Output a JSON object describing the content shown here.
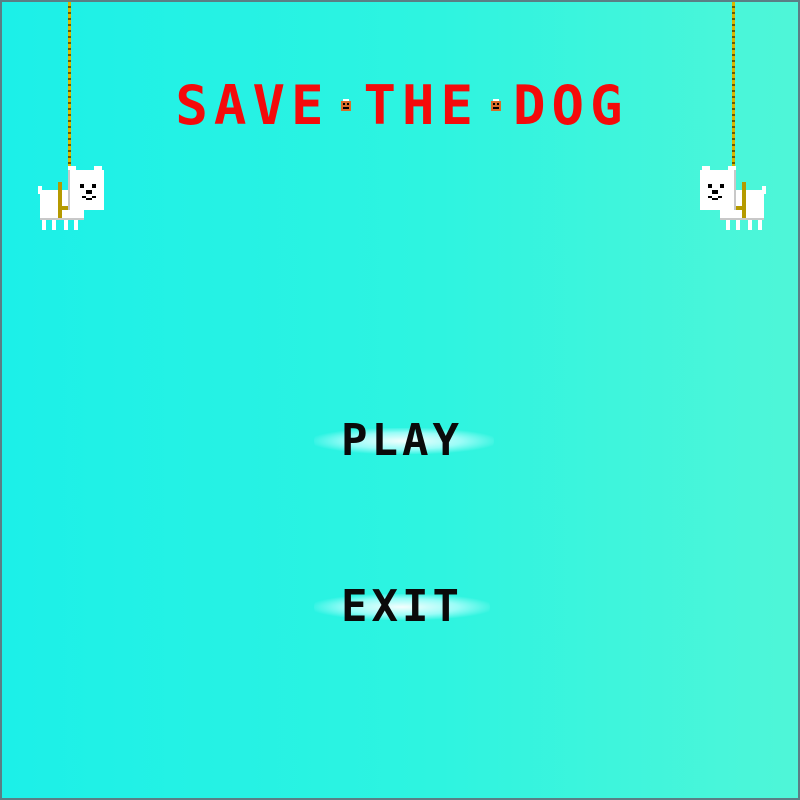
{
  "title": {
    "words": [
      "SAVE",
      "THE",
      "DOG"
    ],
    "color": "#f40a0a",
    "separator_icon": "bee-icon"
  },
  "menu": {
    "play_label": "PLAY",
    "exit_label": "EXIT"
  },
  "background": {
    "gradient_start": "#1cf0e8",
    "gradient_end": "#4ff6d8"
  },
  "decor": {
    "left_icon": "hanging-dog-icon",
    "right_icon": "hanging-dog-icon",
    "rope_color": "#d8b700"
  }
}
